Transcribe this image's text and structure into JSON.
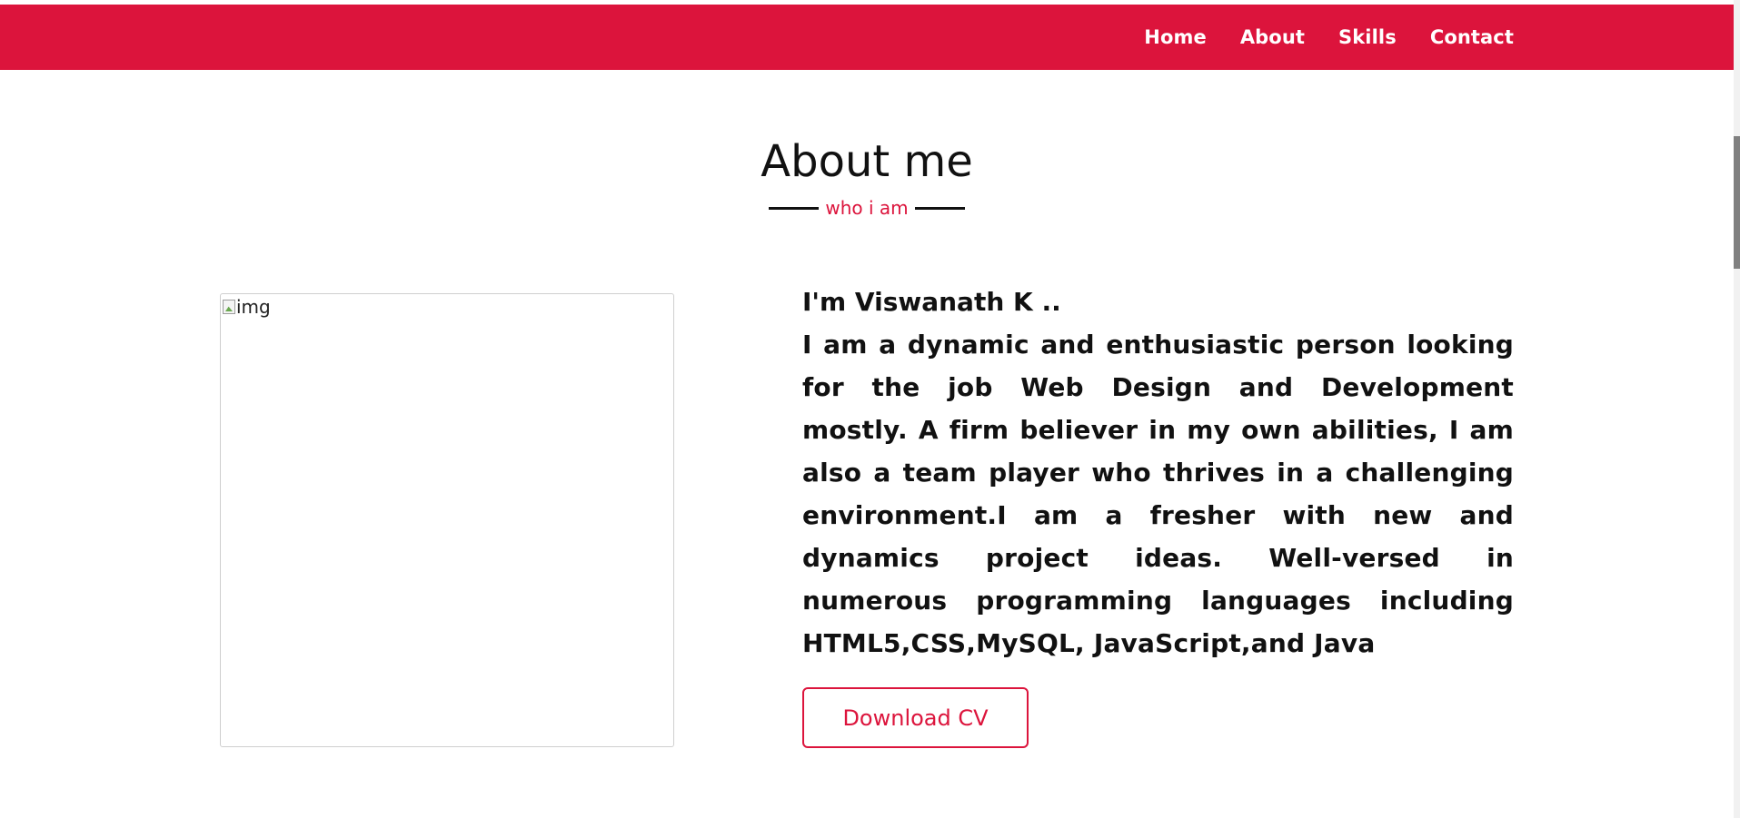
{
  "navbar": {
    "items": [
      {
        "label": "Home"
      },
      {
        "label": "About"
      },
      {
        "label": "Skills"
      },
      {
        "label": "Contact"
      }
    ],
    "background_color": "#dc143c"
  },
  "about": {
    "title": "About me",
    "subtitle": "who i am",
    "image_alt": "img",
    "name_line": "I'm Viswanath K ..",
    "description": "I am a dynamic and enthusiastic person looking for the job Web Design and Development mostly. A firm believer in my own abilities, I am also a team player who thrives in a challenging environment.I am a fresher with new and dynamics project ideas. Well-versed in numerous programming languages including HTML5,CSS,MySQL, JavaScript,and Java",
    "cv_button_label": "Download CV",
    "accent_color": "#dc143c"
  }
}
